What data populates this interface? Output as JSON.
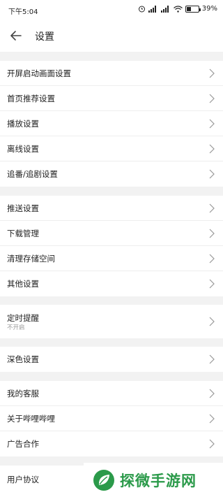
{
  "status": {
    "time": "下午5:04",
    "battery": "39%",
    "battery_level": 0.39
  },
  "header": {
    "title": "设置"
  },
  "groups": [
    {
      "items": [
        {
          "label": "开屏启动画面设置"
        },
        {
          "label": "首页推荐设置"
        },
        {
          "label": "播放设置"
        },
        {
          "label": "离线设置"
        },
        {
          "label": "追番/追剧设置"
        }
      ]
    },
    {
      "items": [
        {
          "label": "推送设置"
        },
        {
          "label": "下载管理"
        },
        {
          "label": "清理存储空间"
        },
        {
          "label": "其他设置"
        }
      ]
    },
    {
      "items": [
        {
          "label": "定时提醒",
          "sub": "不开启"
        }
      ]
    },
    {
      "items": [
        {
          "label": "深色设置"
        }
      ]
    },
    {
      "items": [
        {
          "label": "我的客服"
        },
        {
          "label": "关于哔哩哔哩"
        },
        {
          "label": "广告合作"
        }
      ]
    },
    {
      "items": [
        {
          "label": "用户协议"
        }
      ]
    }
  ],
  "watermark": {
    "text": "探微手游网",
    "color": "#2b9a4a"
  }
}
